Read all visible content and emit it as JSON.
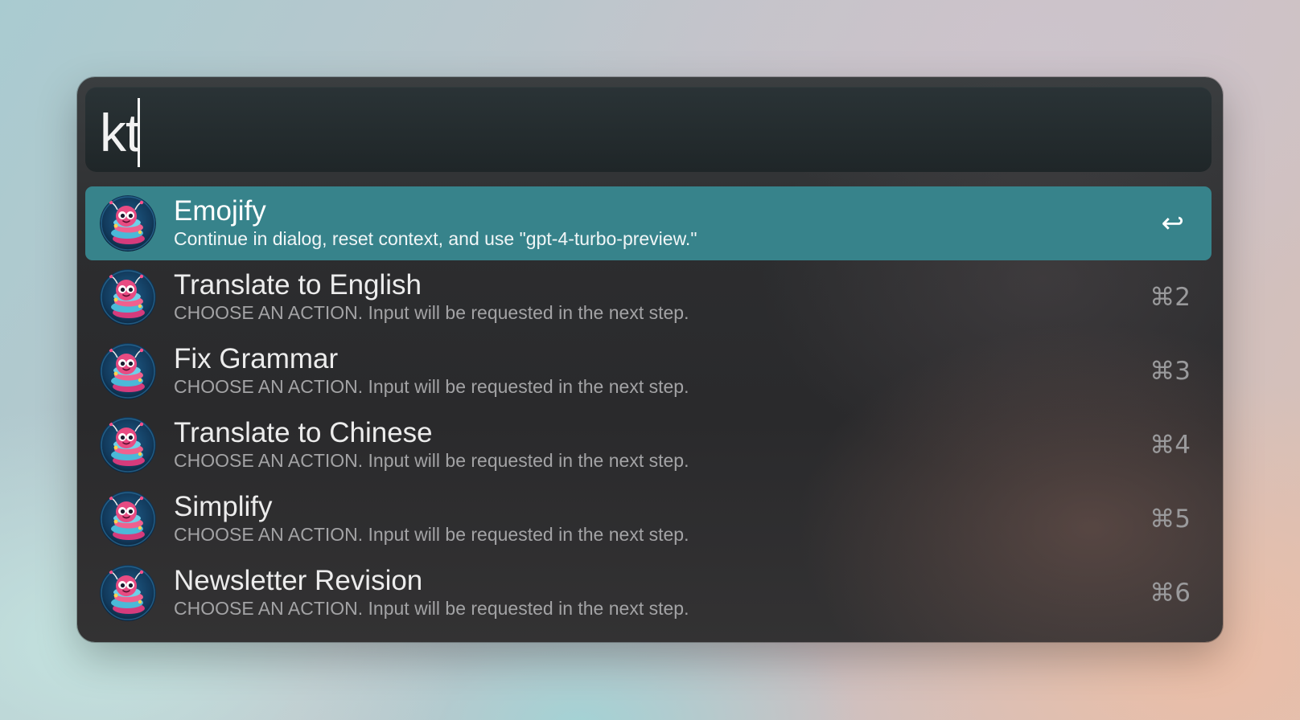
{
  "search": {
    "query": "kt"
  },
  "results": [
    {
      "title": "Emojify",
      "subtitle": "Continue in dialog, reset context, and use \"gpt-4-turbo-preview.\"",
      "shortcut": "↩",
      "selected": true,
      "icon": "bug-mascot-icon"
    },
    {
      "title": "Translate to English",
      "subtitle": "CHOOSE AN ACTION. Input will be requested in the next step.",
      "shortcut": "⌘2",
      "selected": false,
      "icon": "bug-mascot-icon"
    },
    {
      "title": "Fix Grammar",
      "subtitle": "CHOOSE AN ACTION. Input will be requested in the next step.",
      "shortcut": "⌘3",
      "selected": false,
      "icon": "bug-mascot-icon"
    },
    {
      "title": "Translate to Chinese",
      "subtitle": "CHOOSE AN ACTION. Input will be requested in the next step.",
      "shortcut": "⌘4",
      "selected": false,
      "icon": "bug-mascot-icon"
    },
    {
      "title": "Simplify",
      "subtitle": "CHOOSE AN ACTION. Input will be requested in the next step.",
      "shortcut": "⌘5",
      "selected": false,
      "icon": "bug-mascot-icon"
    },
    {
      "title": "Newsletter Revision",
      "subtitle": "CHOOSE AN ACTION. Input will be requested in the next step.",
      "shortcut": "⌘6",
      "selected": false,
      "icon": "bug-mascot-icon"
    }
  ],
  "colors": {
    "selection": "#37838b",
    "panel": "#2c2d2f",
    "search_field": "#1f2628"
  }
}
